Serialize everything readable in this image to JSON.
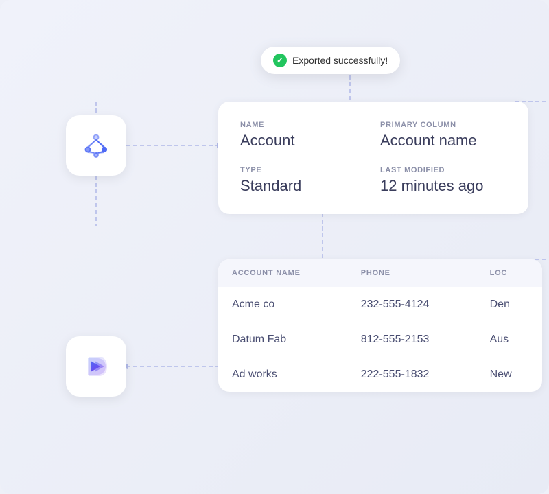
{
  "colors": {
    "background": "#eef0f8",
    "card_bg": "#ffffff",
    "accent_blue": "#4f6af5",
    "text_dark": "#3a3d5c",
    "text_muted": "#8b8fa8",
    "text_value": "#4a4e72",
    "success": "#22c55e",
    "border": "#e8eaf2",
    "table_header_bg": "#f5f6fc"
  },
  "toast": {
    "message": "Exported successfully!"
  },
  "info_card": {
    "fields": [
      {
        "label": "NAME",
        "value": "Account"
      },
      {
        "label": "PRIMARY COLUMN",
        "value": "Account name"
      },
      {
        "label": "TYPE",
        "value": "Standard"
      },
      {
        "label": "LAST MODIFIED",
        "value": "12 minutes ago"
      }
    ]
  },
  "table_card": {
    "columns": [
      "ACCOUNT NAME",
      "PHONE",
      "LOC"
    ],
    "rows": [
      [
        "Acme co",
        "232-555-4124",
        "Den"
      ],
      [
        "Datum Fab",
        "812-555-2153",
        "Aus"
      ],
      [
        "Ad works",
        "222-555-1832",
        "New"
      ]
    ]
  },
  "icons": {
    "top_icon": "network-icon",
    "bottom_icon": "dynamics-icon"
  }
}
